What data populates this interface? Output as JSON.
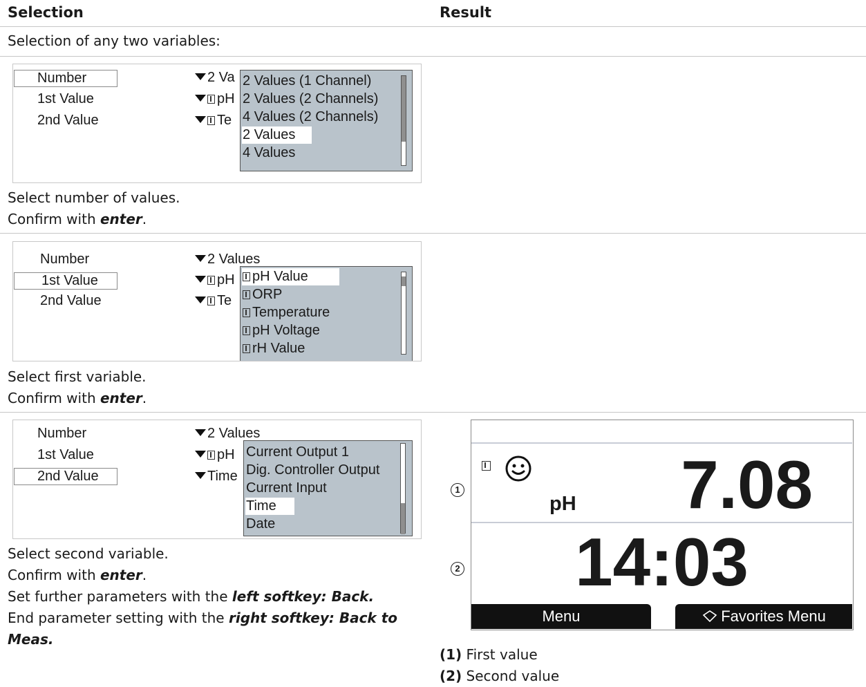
{
  "headers": {
    "selection": "Selection",
    "result": "Result"
  },
  "intro": "Selection of any two variables:",
  "step1": {
    "labels": [
      "Number",
      "1st Value",
      "2nd Value"
    ],
    "values": [
      "2 Va",
      "pH",
      "Te"
    ],
    "dropdown": [
      "2 Values (1 Channel)",
      "2 Values (2 Channels)",
      "4 Values (2 Channels)",
      "2 Values",
      "4 Values"
    ],
    "highlighted": "2 Values",
    "instruction1": "Select number of values.",
    "confirm_prefix": "Confirm with ",
    "confirm_key": "enter",
    "confirm_suffix": "."
  },
  "step2": {
    "labels": [
      "Number",
      "1st Value",
      "2nd Value"
    ],
    "values": [
      "2 Values",
      "pH",
      "Te"
    ],
    "dropdown": [
      "pH Value",
      "ORP",
      "Temperature",
      "pH Voltage",
      "rH Value"
    ],
    "highlighted": "pH Value",
    "instruction1": "Select first variable.",
    "confirm_prefix": "Confirm with ",
    "confirm_key": "enter",
    "confirm_suffix": "."
  },
  "step3": {
    "labels": [
      "Number",
      "1st Value",
      "2nd Value"
    ],
    "values": [
      "2 Values",
      "pH",
      "Time"
    ],
    "dropdown": [
      "Current Output 1",
      "Dig. Controller Output",
      "Current Input",
      "Time",
      "Date"
    ],
    "highlighted": "Time",
    "instruction1": "Select second variable.",
    "confirm_prefix": "Confirm with ",
    "confirm_key": "enter",
    "confirm_suffix": ".",
    "further_prefix": "Set further parameters with the ",
    "further_key": "left softkey: Back.",
    "end_prefix": "End parameter setting with the ",
    "end_key_line1": "right softkey: Back to",
    "end_key_line2": "Meas."
  },
  "device": {
    "first_unit": "pH",
    "first_value": "7.08",
    "second_value": "14:03",
    "status_icon": "smiley-icon",
    "softkey_left": "Menu",
    "softkey_right": "Favorites Menu",
    "callout1": "1",
    "callout2": "2"
  },
  "legend": [
    {
      "num": "(1)",
      "text": " First value"
    },
    {
      "num": "(2)",
      "text": " Second value"
    }
  ]
}
